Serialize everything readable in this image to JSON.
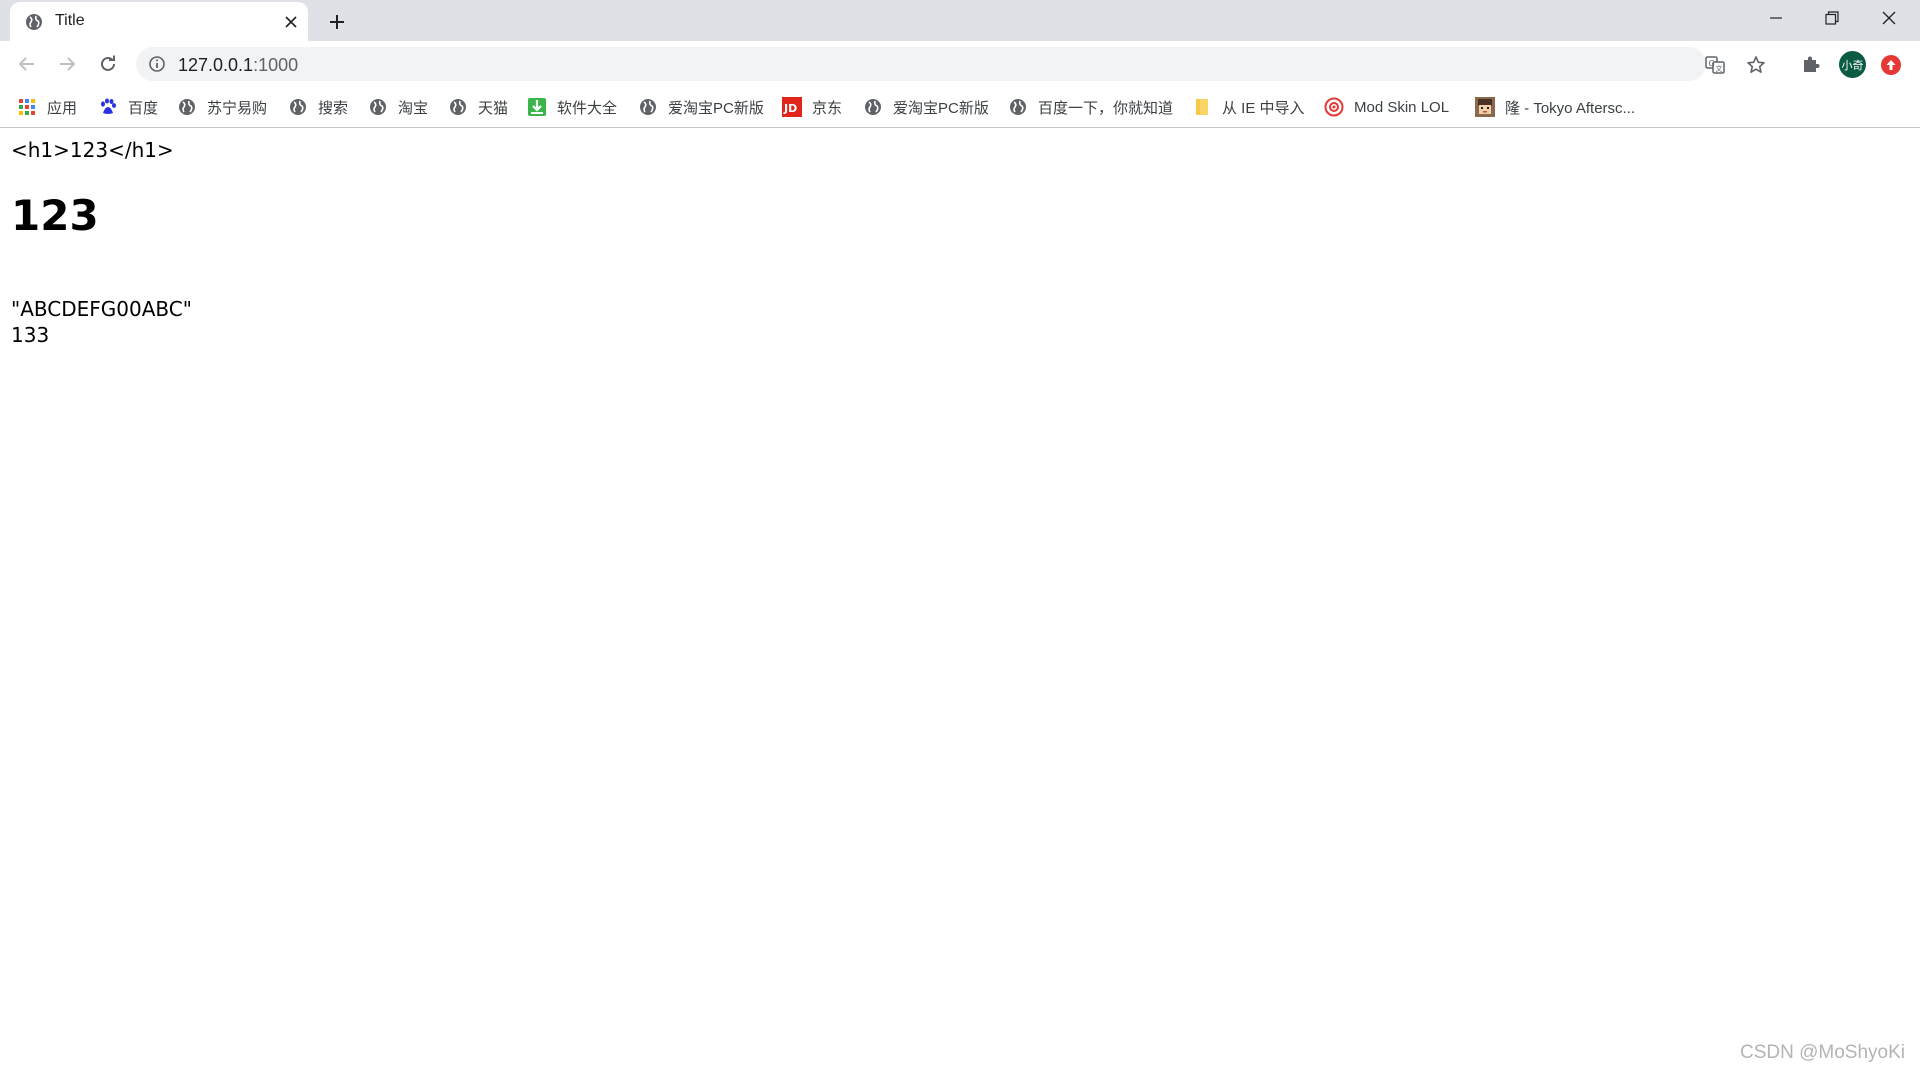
{
  "tab": {
    "title": "Title",
    "favicon": "globe-icon",
    "close_icon": "close-icon",
    "new_tab_icon": "plus-icon"
  },
  "window_controls": [
    "minimize-icon",
    "restore-icon",
    "close-icon"
  ],
  "toolbar": {
    "url_host": "127.0.0.1",
    "url_port": ":1000",
    "icons": [
      "back-icon",
      "forward-icon",
      "reload-icon",
      "info-icon",
      "translate-icon",
      "star-icon",
      "extensions-icon"
    ],
    "profile_label": "小奇"
  },
  "bookmarks": [
    {
      "label": "应用",
      "icon": "apps-grid-icon"
    },
    {
      "label": "百度",
      "icon": "baidu-paw-icon"
    },
    {
      "label": "苏宁易购",
      "icon": "globe-icon"
    },
    {
      "label": "搜索",
      "icon": "globe-icon"
    },
    {
      "label": "淘宝",
      "icon": "globe-icon"
    },
    {
      "label": "天猫",
      "icon": "globe-icon"
    },
    {
      "label": "软件大全",
      "icon": "download-icon"
    },
    {
      "label": "爱淘宝PC新版",
      "icon": "globe-icon"
    },
    {
      "label": "京东",
      "icon": "jd-logo-icon"
    },
    {
      "label": "爱淘宝PC新版",
      "icon": "globe-icon"
    },
    {
      "label": "百度一下，你就知道",
      "icon": "globe-icon"
    },
    {
      "label": "从 IE 中导入",
      "icon": "folder-icon"
    },
    {
      "label": "Mod Skin LOL",
      "icon": "modskin-icon"
    },
    {
      "label": "隆 - Tokyo Aftersc...",
      "icon": "avatar-thumbnail-icon"
    }
  ],
  "page": {
    "code_text": "<h1>123</h1>",
    "heading": "123",
    "line1": "\"ABCDEFG00ABC\"",
    "line2": "133"
  },
  "watermark": "CSDN @MoShyoKi",
  "colors": {
    "tabstrip": "#dee1e6",
    "omnibox": "#f1f3f4",
    "avatar": "#0a5a44",
    "red_extension": "#e53935",
    "jd_red": "#e1251b",
    "download_green": "#3ab54a"
  }
}
